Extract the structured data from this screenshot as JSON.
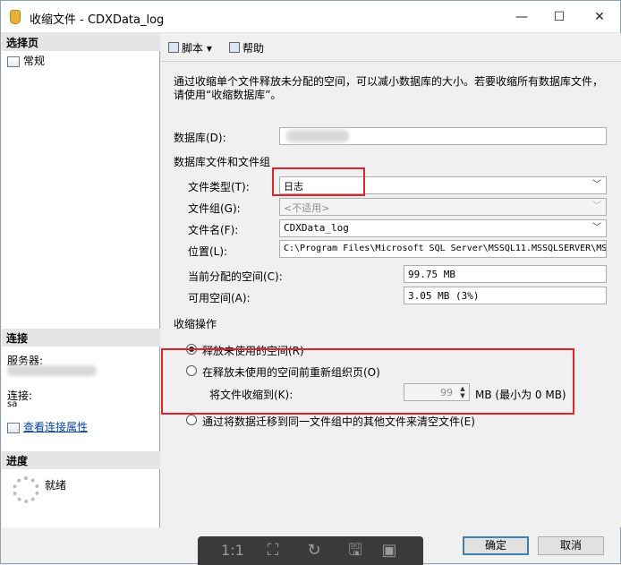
{
  "window": {
    "title": "收缩文件 - CDXData_log",
    "minimize_glyph": "—",
    "maximize_glyph": "☐",
    "close_glyph": "✕"
  },
  "left_pane": {
    "select_page_header": "选择页",
    "pages": [
      {
        "label": "常规"
      }
    ],
    "connection_header": "连接",
    "server_label": "服务器:",
    "connection_label": "连接:",
    "connection_value": "sa",
    "view_connection_properties": "查看连接属性",
    "progress_header": "进度",
    "progress_status": "就绪"
  },
  "toolbar": {
    "script_label": "脚本",
    "script_dropdown_glyph": "▾",
    "help_label": "帮助"
  },
  "description": "通过收缩单个文件释放未分配的空间，可以减小数据库的大小。若要收缩所有数据库文件，请使用“收缩数据库”。",
  "database": {
    "label": "数据库(D):",
    "value": ""
  },
  "files_group": {
    "header": "数据库文件和文件组",
    "file_type_label": "文件类型(T):",
    "file_type_value": "日志",
    "filegroup_label": "文件组(G):",
    "filegroup_value": "<不适用>",
    "filename_label": "文件名(F):",
    "filename_value": "CDXData_log",
    "location_label": "位置(L):",
    "location_value": "C:\\Program Files\\Microsoft SQL Server\\MSSQL11.MSSQLSERVER\\MSSQL",
    "allocated_label": "当前分配的空间(C):",
    "allocated_value": "99.75 MB",
    "free_label": "可用空间(A):",
    "free_value": "3.05 MB (3%)"
  },
  "shrink_action": {
    "header": "收缩操作",
    "option_release": "释放未使用的空间(R)",
    "option_reorganize": "在释放未使用的空间前重新组织页(O)",
    "shrink_to_label": "将文件收缩到(K):",
    "shrink_to_value": "99",
    "shrink_to_hint": "MB (最小为 0 MB)",
    "option_empty": "通过将数据迁移到同一文件组中的其他文件来清空文件(E)",
    "selected_option": "release"
  },
  "buttons": {
    "ok": "确定",
    "cancel": "取消"
  },
  "viewer_bar": {
    "ratio_label": "1:1"
  },
  "colors": {
    "highlight": "#e0242d",
    "link": "#0645ad"
  }
}
